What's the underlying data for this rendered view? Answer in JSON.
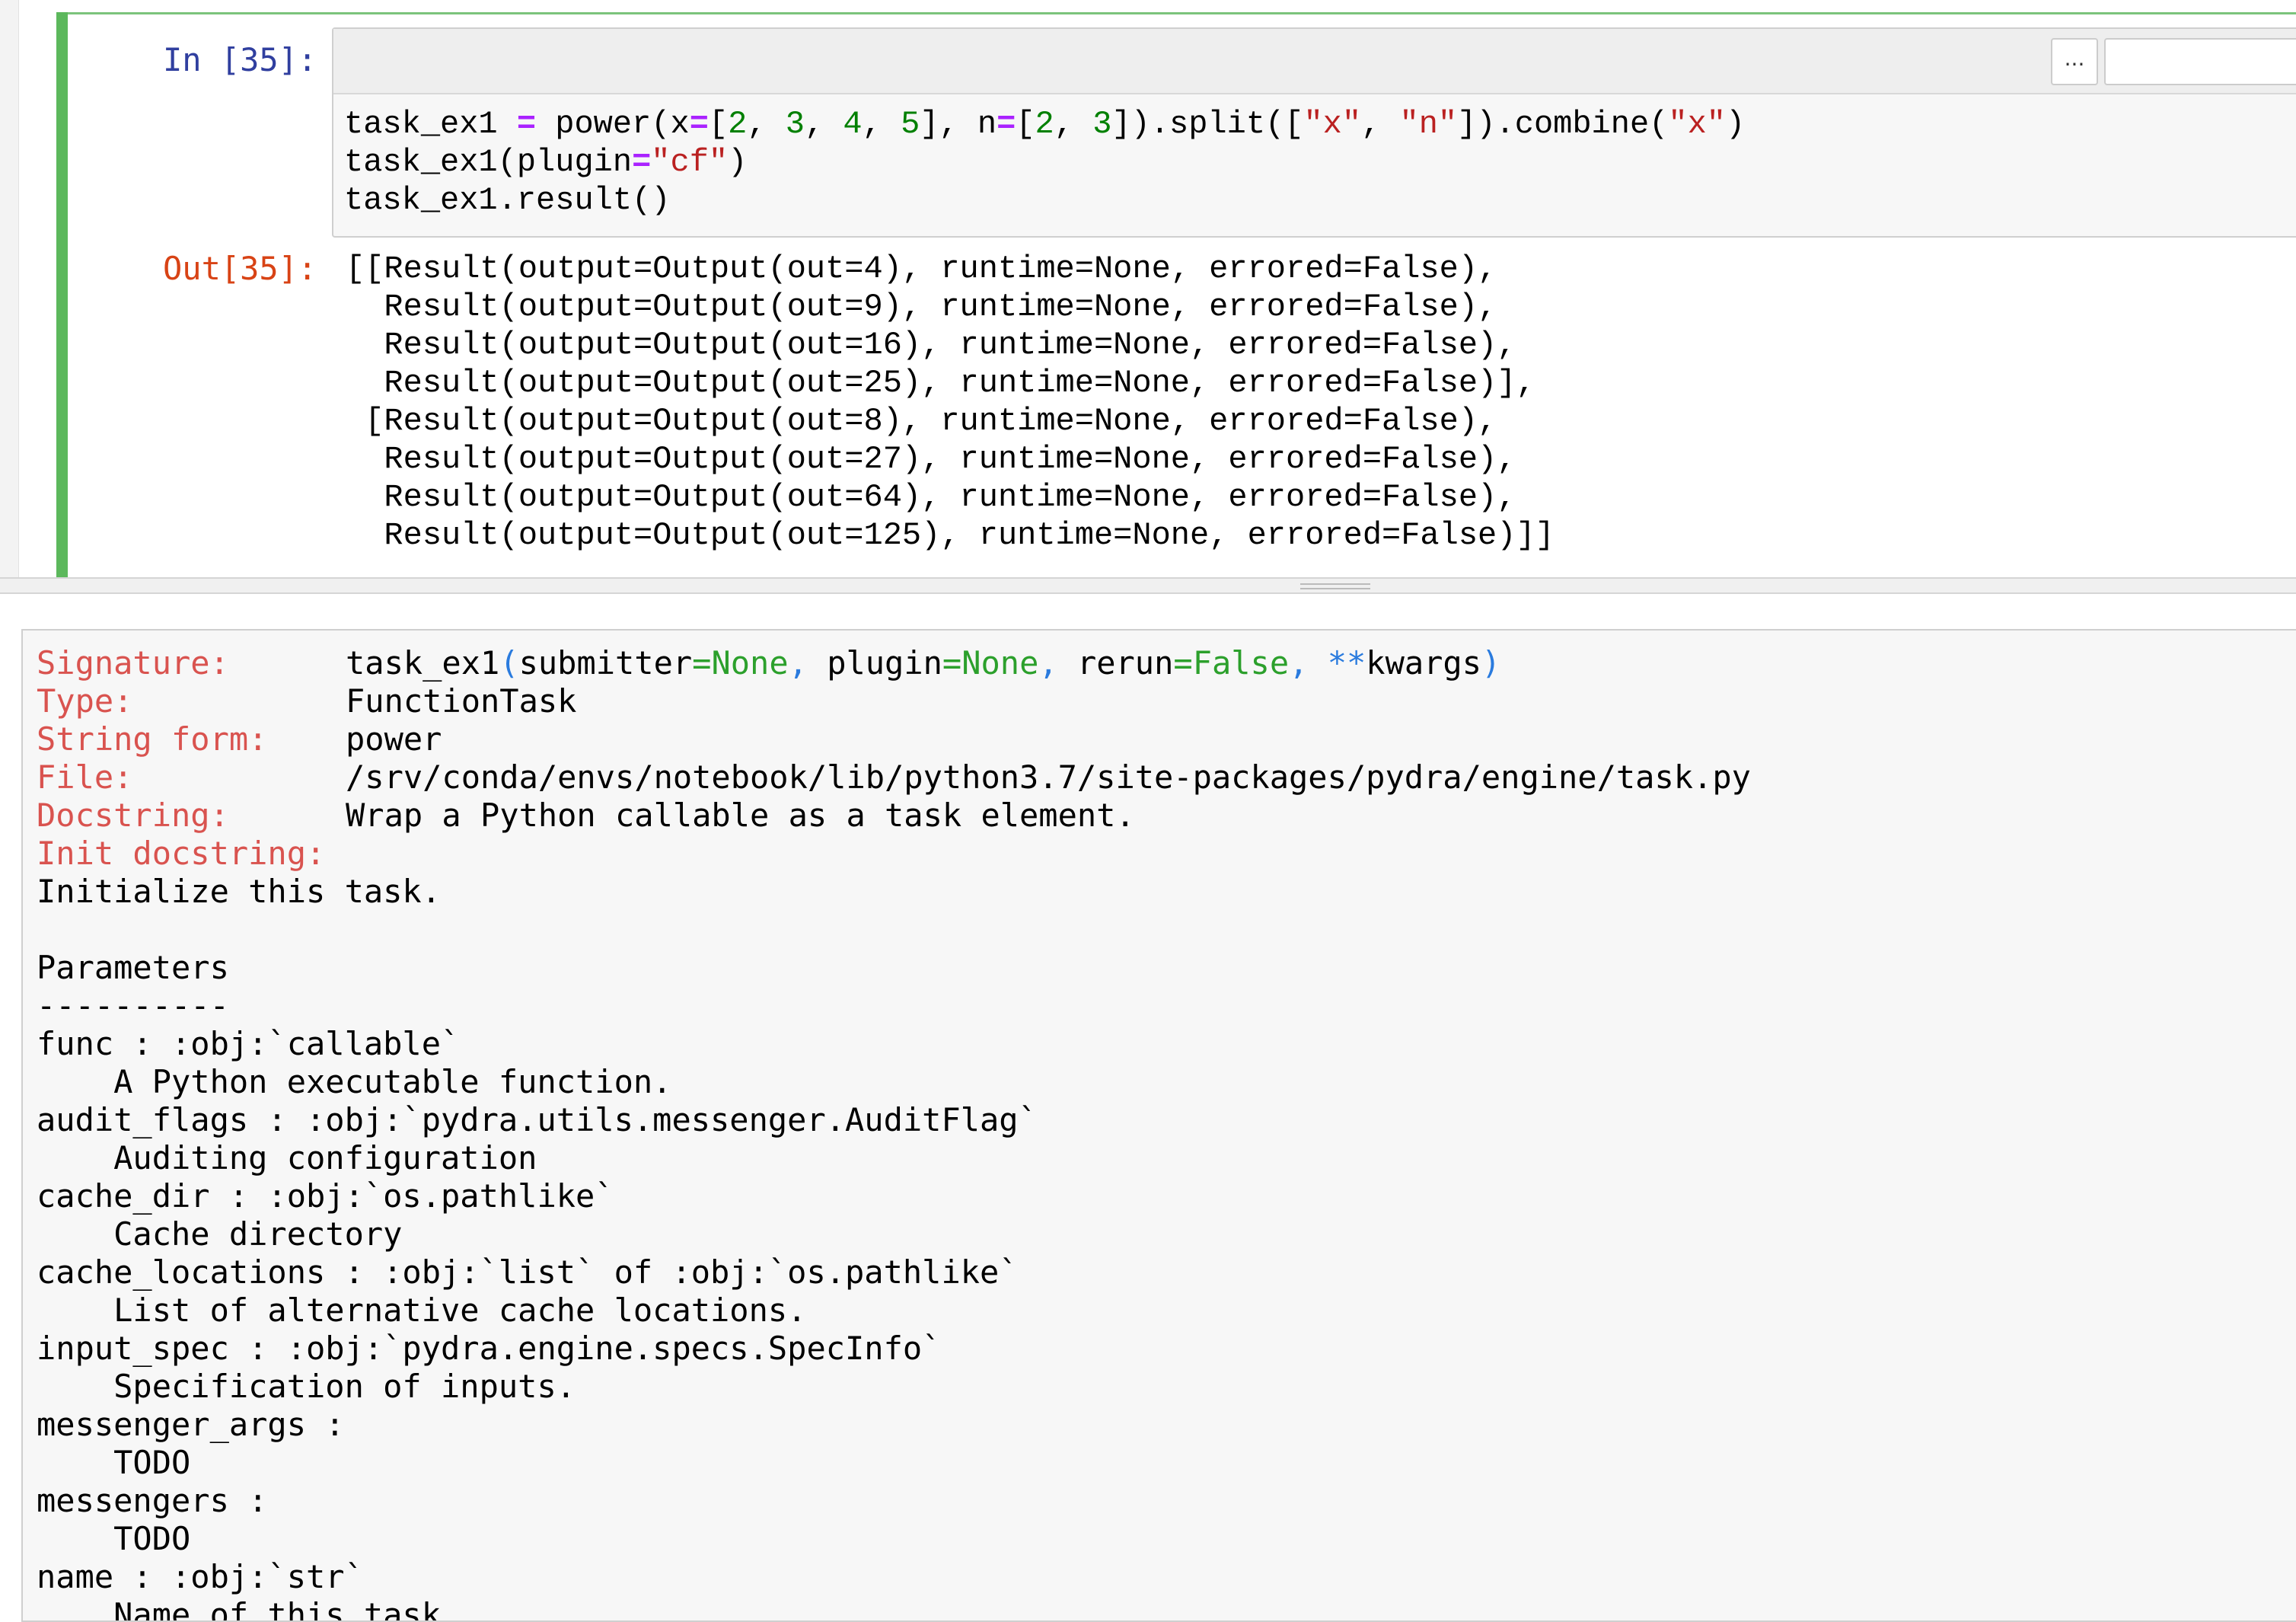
{
  "cell": {
    "in_prompt": "In [35]:",
    "out_prompt": "Out[35]:",
    "toolbar": {
      "more_label": "..."
    },
    "code": {
      "line1": {
        "a": "task_ex1 ",
        "eq1": "=",
        "b": " power(x",
        "eq2": "=",
        "c": "[",
        "n2": "2",
        "c1": ", ",
        "n3": "3",
        "c2": ", ",
        "n4": "4",
        "c3": ", ",
        "n5": "5",
        "d": "], n",
        "eq3": "=",
        "e": "[",
        "m2": "2",
        "c4": ", ",
        "m3": "3",
        "f": "]).split([",
        "s1": "\"x\"",
        "c5": ", ",
        "s2": "\"n\"",
        "g": "]).combine(",
        "s3": "\"x\"",
        "h": ")"
      },
      "line2": {
        "a": "task_ex1(plugin",
        "eq": "=",
        "s": "\"cf\"",
        "b": ")"
      },
      "line3": "task_ex1.result()"
    },
    "output_lines": [
      "[[Result(output=Output(out=4), runtime=None, errored=False),",
      "  Result(output=Output(out=9), runtime=None, errored=False),",
      "  Result(output=Output(out=16), runtime=None, errored=False),",
      "  Result(output=Output(out=25), runtime=None, errored=False)],",
      " [Result(output=Output(out=8), runtime=None, errored=False),",
      "  Result(output=Output(out=27), runtime=None, errored=False),",
      "  Result(output=Output(out=64), runtime=None, errored=False),",
      "  Result(output=Output(out=125), runtime=None, errored=False)]]"
    ]
  },
  "pager": {
    "signature": {
      "label": "Signature:",
      "name": "task_ex1",
      "open": "(",
      "p1": "submitter",
      "eq1": "=",
      "v1": "None",
      "sep1": ", ",
      "p2": "plugin",
      "eq2": "=",
      "v2": "None",
      "sep2": ", ",
      "p3": "rerun",
      "eq3": "=",
      "v3": "False",
      "sep3": ", ",
      "star": "**",
      "p4": "kwargs",
      "close": ")"
    },
    "type": {
      "label": "Type:",
      "value": "FunctionTask"
    },
    "string_form": {
      "label": "String form:",
      "value": "power"
    },
    "file": {
      "label": "File:",
      "value": "/srv/conda/envs/notebook/lib/python3.7/site-packages/pydra/engine/task.py"
    },
    "docstring": {
      "label": "Docstring:",
      "value": "Wrap a Python callable as a task element."
    },
    "init_docstring": {
      "label": "Init docstring:"
    },
    "doc_lines": [
      "Initialize this task.",
      "",
      "Parameters",
      "----------",
      "func : :obj:`callable`",
      "    A Python executable function.",
      "audit_flags : :obj:`pydra.utils.messenger.AuditFlag`",
      "    Auditing configuration",
      "cache_dir : :obj:`os.pathlike`",
      "    Cache directory",
      "cache_locations : :obj:`list` of :obj:`os.pathlike`",
      "    List of alternative cache locations.",
      "input_spec : :obj:`pydra.engine.specs.SpecInfo`",
      "    Specification of inputs.",
      "messenger_args :",
      "    TODO",
      "messengers :",
      "    TODO",
      "name : :obj:`str`",
      "    Name of this task."
    ]
  }
}
